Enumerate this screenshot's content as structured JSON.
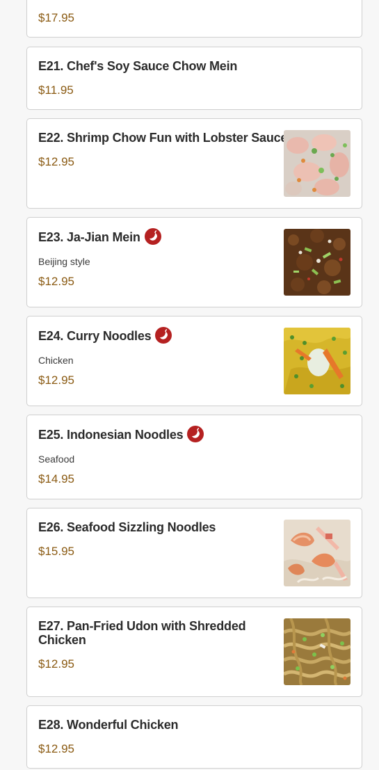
{
  "items": [
    {
      "id": "e20",
      "price": "$17.95"
    },
    {
      "id": "e21",
      "name": "E21. Chef's Soy Sauce Chow Mein",
      "price": "$11.95"
    },
    {
      "id": "e22",
      "name": "E22. Shrimp Chow Fun with Lobster Sauce",
      "price": "$12.95"
    },
    {
      "id": "e23",
      "name": "E23. Ja-Jian Mein",
      "description": "Beijing style",
      "price": "$12.95"
    },
    {
      "id": "e24",
      "name": "E24. Curry Noodles",
      "description": "Chicken",
      "price": "$12.95"
    },
    {
      "id": "e25",
      "name": "E25. Indonesian Noodles",
      "description": "Seafood",
      "price": "$14.95"
    },
    {
      "id": "e26",
      "name": "E26. Seafood Sizzling Noodles",
      "price": "$15.95"
    },
    {
      "id": "e27",
      "name": "E27. Pan-Fried Udon with Shredded Chicken",
      "price": "$12.95"
    },
    {
      "id": "e28",
      "name": "E28. Wonderful Chicken",
      "price": "$12.95"
    }
  ],
  "icons": {
    "spicy": "chili-pepper-icon"
  },
  "colors": {
    "price": "#8a5a12",
    "spicy_badge": "#b52121",
    "card_border": "#cfcfcf",
    "page_background": "#f7f7f7"
  }
}
